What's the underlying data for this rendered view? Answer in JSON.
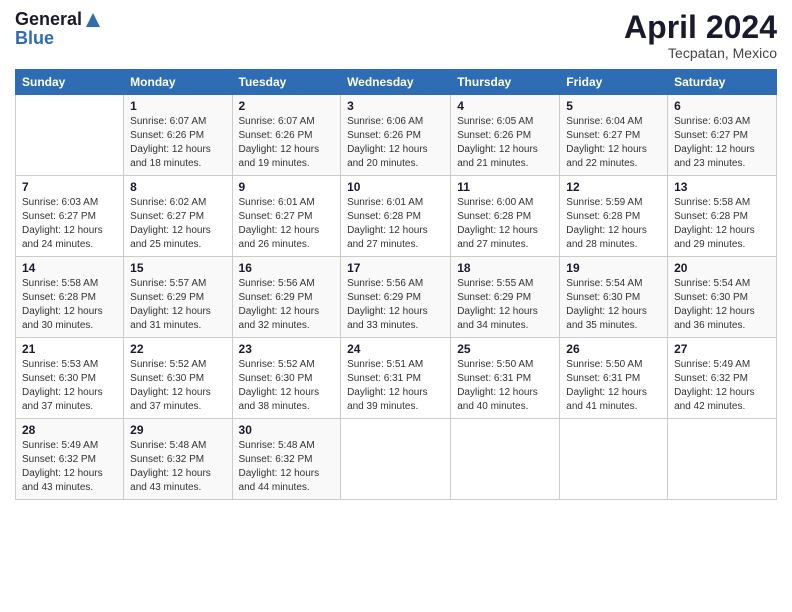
{
  "header": {
    "logo_line1": "General",
    "logo_line2": "Blue",
    "month": "April 2024",
    "location": "Tecpatan, Mexico"
  },
  "weekdays": [
    "Sunday",
    "Monday",
    "Tuesday",
    "Wednesday",
    "Thursday",
    "Friday",
    "Saturday"
  ],
  "weeks": [
    [
      {
        "day": "",
        "sunrise": "",
        "sunset": "",
        "daylight": ""
      },
      {
        "day": "1",
        "sunrise": "6:07 AM",
        "sunset": "6:26 PM",
        "daylight": "12 hours and 18 minutes."
      },
      {
        "day": "2",
        "sunrise": "6:07 AM",
        "sunset": "6:26 PM",
        "daylight": "12 hours and 19 minutes."
      },
      {
        "day": "3",
        "sunrise": "6:06 AM",
        "sunset": "6:26 PM",
        "daylight": "12 hours and 20 minutes."
      },
      {
        "day": "4",
        "sunrise": "6:05 AM",
        "sunset": "6:26 PM",
        "daylight": "12 hours and 21 minutes."
      },
      {
        "day": "5",
        "sunrise": "6:04 AM",
        "sunset": "6:27 PM",
        "daylight": "12 hours and 22 minutes."
      },
      {
        "day": "6",
        "sunrise": "6:03 AM",
        "sunset": "6:27 PM",
        "daylight": "12 hours and 23 minutes."
      }
    ],
    [
      {
        "day": "7",
        "sunrise": "6:03 AM",
        "sunset": "6:27 PM",
        "daylight": "12 hours and 24 minutes."
      },
      {
        "day": "8",
        "sunrise": "6:02 AM",
        "sunset": "6:27 PM",
        "daylight": "12 hours and 25 minutes."
      },
      {
        "day": "9",
        "sunrise": "6:01 AM",
        "sunset": "6:27 PM",
        "daylight": "12 hours and 26 minutes."
      },
      {
        "day": "10",
        "sunrise": "6:01 AM",
        "sunset": "6:28 PM",
        "daylight": "12 hours and 27 minutes."
      },
      {
        "day": "11",
        "sunrise": "6:00 AM",
        "sunset": "6:28 PM",
        "daylight": "12 hours and 27 minutes."
      },
      {
        "day": "12",
        "sunrise": "5:59 AM",
        "sunset": "6:28 PM",
        "daylight": "12 hours and 28 minutes."
      },
      {
        "day": "13",
        "sunrise": "5:58 AM",
        "sunset": "6:28 PM",
        "daylight": "12 hours and 29 minutes."
      }
    ],
    [
      {
        "day": "14",
        "sunrise": "5:58 AM",
        "sunset": "6:28 PM",
        "daylight": "12 hours and 30 minutes."
      },
      {
        "day": "15",
        "sunrise": "5:57 AM",
        "sunset": "6:29 PM",
        "daylight": "12 hours and 31 minutes."
      },
      {
        "day": "16",
        "sunrise": "5:56 AM",
        "sunset": "6:29 PM",
        "daylight": "12 hours and 32 minutes."
      },
      {
        "day": "17",
        "sunrise": "5:56 AM",
        "sunset": "6:29 PM",
        "daylight": "12 hours and 33 minutes."
      },
      {
        "day": "18",
        "sunrise": "5:55 AM",
        "sunset": "6:29 PM",
        "daylight": "12 hours and 34 minutes."
      },
      {
        "day": "19",
        "sunrise": "5:54 AM",
        "sunset": "6:30 PM",
        "daylight": "12 hours and 35 minutes."
      },
      {
        "day": "20",
        "sunrise": "5:54 AM",
        "sunset": "6:30 PM",
        "daylight": "12 hours and 36 minutes."
      }
    ],
    [
      {
        "day": "21",
        "sunrise": "5:53 AM",
        "sunset": "6:30 PM",
        "daylight": "12 hours and 37 minutes."
      },
      {
        "day": "22",
        "sunrise": "5:52 AM",
        "sunset": "6:30 PM",
        "daylight": "12 hours and 37 minutes."
      },
      {
        "day": "23",
        "sunrise": "5:52 AM",
        "sunset": "6:30 PM",
        "daylight": "12 hours and 38 minutes."
      },
      {
        "day": "24",
        "sunrise": "5:51 AM",
        "sunset": "6:31 PM",
        "daylight": "12 hours and 39 minutes."
      },
      {
        "day": "25",
        "sunrise": "5:50 AM",
        "sunset": "6:31 PM",
        "daylight": "12 hours and 40 minutes."
      },
      {
        "day": "26",
        "sunrise": "5:50 AM",
        "sunset": "6:31 PM",
        "daylight": "12 hours and 41 minutes."
      },
      {
        "day": "27",
        "sunrise": "5:49 AM",
        "sunset": "6:32 PM",
        "daylight": "12 hours and 42 minutes."
      }
    ],
    [
      {
        "day": "28",
        "sunrise": "5:49 AM",
        "sunset": "6:32 PM",
        "daylight": "12 hours and 43 minutes."
      },
      {
        "day": "29",
        "sunrise": "5:48 AM",
        "sunset": "6:32 PM",
        "daylight": "12 hours and 43 minutes."
      },
      {
        "day": "30",
        "sunrise": "5:48 AM",
        "sunset": "6:32 PM",
        "daylight": "12 hours and 44 minutes."
      },
      {
        "day": "",
        "sunrise": "",
        "sunset": "",
        "daylight": ""
      },
      {
        "day": "",
        "sunrise": "",
        "sunset": "",
        "daylight": ""
      },
      {
        "day": "",
        "sunrise": "",
        "sunset": "",
        "daylight": ""
      },
      {
        "day": "",
        "sunrise": "",
        "sunset": "",
        "daylight": ""
      }
    ]
  ]
}
